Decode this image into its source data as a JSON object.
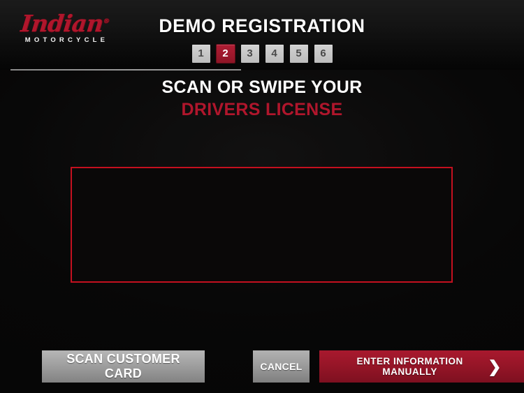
{
  "brand": {
    "script_name": "Indian",
    "registered_mark": "®",
    "sub_name": "MOTORCYCLE"
  },
  "header": {
    "title": "DEMO REGISTRATION",
    "steps": [
      {
        "label": "1",
        "active": false
      },
      {
        "label": "2",
        "active": true
      },
      {
        "label": "3",
        "active": false
      },
      {
        "label": "4",
        "active": false
      },
      {
        "label": "5",
        "active": false
      },
      {
        "label": "6",
        "active": false
      }
    ]
  },
  "prompt": {
    "line1": "SCAN OR SWIPE YOUR",
    "line2": "DRIVERS LICENSE"
  },
  "scan_area": {
    "label": "license-scan-capture-region",
    "border_color": "#c4101f",
    "content": ""
  },
  "footer": {
    "scan_label": "SCAN CUSTOMER CARD",
    "cancel_label": "CANCEL",
    "manual_label": "ENTER INFORMATION MANUALLY",
    "manual_chevron": "❯"
  },
  "colors": {
    "brand_red": "#b0162c",
    "accent_red": "#c4101f",
    "button_red": "#951527",
    "background": "#050505",
    "step_gray": "#c8c8c8"
  }
}
